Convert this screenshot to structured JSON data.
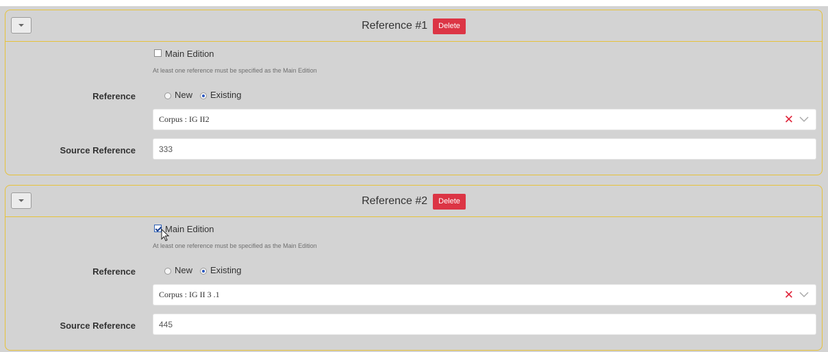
{
  "references": [
    {
      "title": "Reference #1",
      "delete_label": "Delete",
      "main_edition_label": "Main Edition",
      "main_edition_checked": false,
      "hint": "At least one reference must be specified as the Main Edition",
      "reference_label": "Reference",
      "radio_new_label": "New",
      "radio_existing_label": "Existing",
      "selected_radio": "Existing",
      "corpus_value": "Corpus : IG II2",
      "source_reference_label": "Source Reference",
      "source_reference_value": "333"
    },
    {
      "title": "Reference #2",
      "delete_label": "Delete",
      "main_edition_label": "Main Edition",
      "main_edition_checked": true,
      "hint": "At least one reference must be specified as the Main Edition",
      "reference_label": "Reference",
      "radio_new_label": "New",
      "radio_existing_label": "Existing",
      "selected_radio": "Existing",
      "corpus_value": "Corpus : IG II 3 .1",
      "source_reference_label": "Source Reference",
      "source_reference_value": "445"
    }
  ],
  "icons": {
    "toggle": "caret-down-icon",
    "clear": "close-x-icon",
    "dropdown": "chevron-down-icon",
    "cursor": "mouse-pointer-icon"
  },
  "colors": {
    "panel_border": "#e6c23a",
    "delete_button": "#dc3545",
    "clear_icon": "#e0243a",
    "background": "#d3d3d3"
  }
}
